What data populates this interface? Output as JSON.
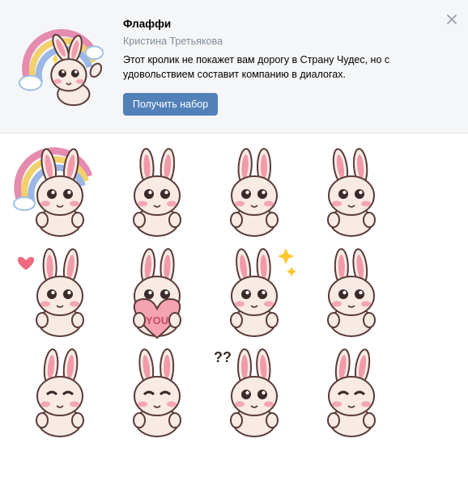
{
  "pack": {
    "title": "Флаффи",
    "author": "Кристина Третьякова",
    "description": "Этот кролик не покажет вам дорогу в Страну Чудес, но с удовольствием составит компанию в диалогах.",
    "get_button": "Получить набор"
  },
  "icons": {
    "close": "close-icon"
  },
  "colors": {
    "accent": "#5181b8",
    "header_bg": "#f5f6f8",
    "muted": "#818c99"
  },
  "stickers": [
    {
      "pose": "rainbow-wave"
    },
    {
      "pose": "thinking"
    },
    {
      "pose": "arms-up"
    },
    {
      "pose": "cheeks-surprised"
    },
    {
      "pose": "blow-kiss-heart"
    },
    {
      "pose": "holding-heart",
      "text": "YOU"
    },
    {
      "pose": "lying-back-sparkles"
    },
    {
      "pose": "peeking-shy"
    },
    {
      "pose": "happy-wink"
    },
    {
      "pose": "smug-chin"
    },
    {
      "pose": "confused",
      "text": "??"
    },
    {
      "pose": "unimpressed"
    }
  ]
}
